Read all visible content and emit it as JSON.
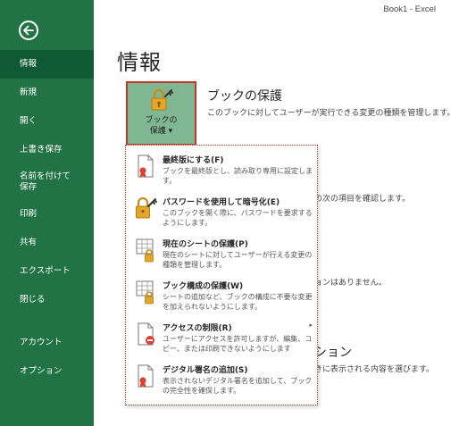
{
  "window": {
    "title": "Book1 - Excel"
  },
  "sidebar": {
    "items": [
      {
        "label": "情報"
      },
      {
        "label": "新規"
      },
      {
        "label": "開く"
      },
      {
        "label": "上書き保存"
      },
      {
        "label_line1": "名前を付けて",
        "label_line2": "保存"
      },
      {
        "label": "印刷"
      },
      {
        "label": "共有"
      },
      {
        "label": "エクスポート"
      },
      {
        "label": "閉じる"
      },
      {
        "label": "アカウント"
      },
      {
        "label": "オプション"
      }
    ],
    "active_index": 0
  },
  "main": {
    "title": "情報",
    "protect": {
      "button_line1": "ブックの",
      "button_line2": "保護 ▾",
      "heading": "ブックの保護",
      "description": "このブックに対してユーザーが実行できる変更の種類を管理します。"
    },
    "background_fragments": {
      "check_items": "の次の項目を確認します。",
      "no_versions": "ョンはありません。",
      "browser_heading": "ション",
      "browser_desc": "きに表示される内容を選びます。"
    }
  },
  "menu": {
    "items": [
      {
        "title": "最終版にする(F)",
        "desc": "ブックを最終版とし、読み取り専用に設定します。",
        "icon": "final-doc-icon"
      },
      {
        "title": "パスワードを使用して暗号化(E)",
        "desc": "このブックを開く際に、パスワードを要求するようにします。",
        "icon": "lock-key-icon"
      },
      {
        "title": "現在のシートの保護(P)",
        "desc": "現在のシートに対してユーザーが行える変更の種類を管理します。",
        "icon": "sheet-lock-icon"
      },
      {
        "title": "ブック構成の保護(W)",
        "desc": "シートの追加など、ブックの構成に不要な変更を加えられないようにします。",
        "icon": "workbook-lock-icon"
      },
      {
        "title": "アクセスの制限(R)",
        "desc": "ユーザーにアクセスを許可しますが、編集、コピー、または印刷できないようにします",
        "icon": "restrict-access-icon",
        "arrow": "▸"
      },
      {
        "title": "デジタル署名の追加(S)",
        "desc": "表示されないデジタル署名を追加して、ブックの完全性を確保します。",
        "icon": "digital-signature-icon"
      }
    ]
  },
  "colors": {
    "sidebar": "#217346",
    "sidebar_active": "#0f5a34",
    "highlight_border": "#c43527",
    "button_bg": "#7fb792",
    "lock_gold": "#e2a72a"
  }
}
